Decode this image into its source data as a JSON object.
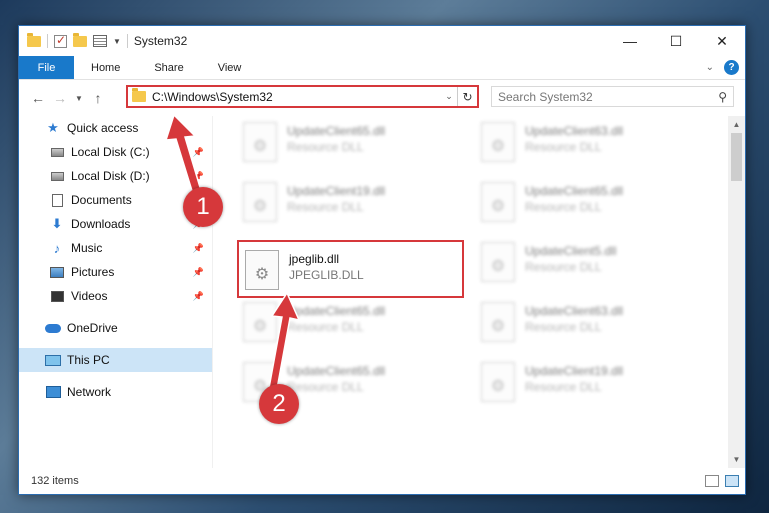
{
  "window": {
    "title": "System32",
    "controls": {
      "minimize": "—",
      "maximize": "☐",
      "close": "✕"
    }
  },
  "ribbon": {
    "file_label": "File",
    "tabs": [
      "Home",
      "Share",
      "View"
    ],
    "help_label": "?"
  },
  "address": {
    "path": "C:\\Windows\\System32",
    "search_placeholder": "Search System32"
  },
  "nav_pane": {
    "quick_access": "Quick access",
    "pinned": [
      {
        "label": "Local Disk (C:)",
        "icon": "local-disk-icon"
      },
      {
        "label": "Local Disk (D:)",
        "icon": "local-disk-icon"
      },
      {
        "label": "Documents",
        "icon": "documents-icon"
      },
      {
        "label": "Downloads",
        "icon": "downloads-icon"
      },
      {
        "label": "Music",
        "icon": "music-icon"
      },
      {
        "label": "Pictures",
        "icon": "pictures-icon"
      },
      {
        "label": "Videos",
        "icon": "videos-icon"
      }
    ],
    "onedrive": "OneDrive",
    "this_pc": "This PC",
    "network": "Network"
  },
  "files": {
    "left": [
      {
        "name": "UpdateClient65.dll",
        "type": "Resource DLL"
      },
      {
        "name": "UpdateClient19.dll",
        "type": "Resource DLL"
      },
      {
        "name": "jpeglib.dll",
        "type": "JPEGLIB.DLL"
      },
      {
        "name": "UpdateClient65.dll",
        "type": "Resource DLL"
      },
      {
        "name": "UpdateClient65.dll",
        "type": "Resource DLL"
      }
    ],
    "right": [
      {
        "name": "UpdateClient63.dll",
        "type": "Resource DLL"
      },
      {
        "name": "UpdateClient65.dll",
        "type": "Resource DLL"
      },
      {
        "name": "UpdateClient5.dll",
        "type": "Resource DLL"
      },
      {
        "name": "UpdateClient63.dll",
        "type": "Resource DLL"
      },
      {
        "name": "UpdateClient19.dll",
        "type": "Resource DLL"
      }
    ]
  },
  "status": {
    "item_count": "132 items"
  },
  "annotations": {
    "step1": "1",
    "step2": "2"
  },
  "colors": {
    "accent": "#1979ca",
    "annotation_red": "#d6383b",
    "selected_bg": "#cce4f7"
  }
}
